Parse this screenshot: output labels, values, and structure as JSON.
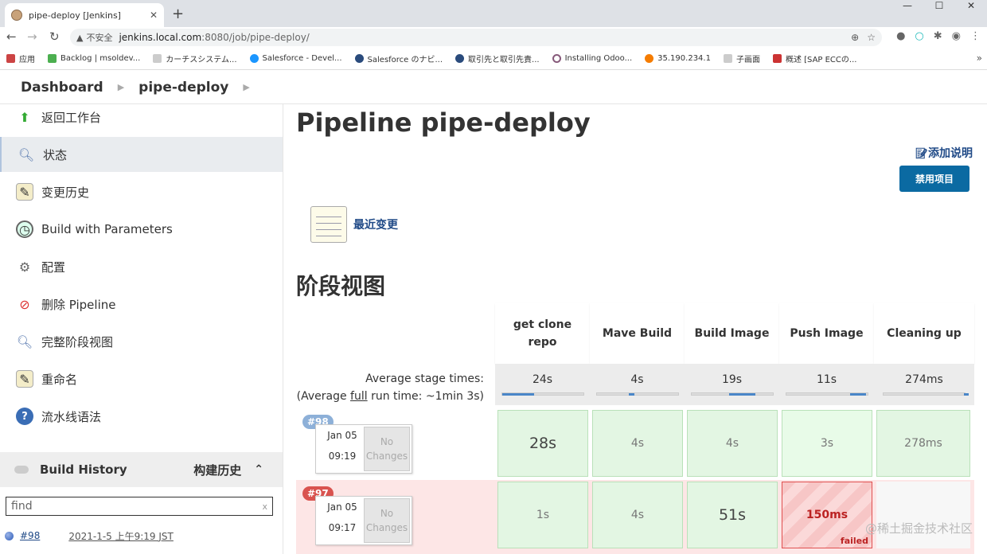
{
  "browser": {
    "tab_title": "pipe-deploy [Jenkins]",
    "url_security": "不安全",
    "url_host": "jenkins.local.com",
    "url_path": ":8080/job/pipe-deploy/",
    "bookmarks": [
      "应用",
      "Backlog | msoldev...",
      "カーチスシステム...",
      "Salesforce - Devel...",
      "Salesforce のナビ...",
      "取引先と取引先責...",
      "Installing Odoo...",
      "35.190.234.1",
      "子画面",
      "概述 [SAP ECCの..."
    ]
  },
  "breadcrumb": {
    "dashboard": "Dashboard",
    "job": "pipe-deploy"
  },
  "sidebar": {
    "items": [
      {
        "label": "返回工作台",
        "icon": "up-arrow-icon"
      },
      {
        "label": "状态",
        "icon": "search-icon"
      },
      {
        "label": "变更历史",
        "icon": "notepad-icon"
      },
      {
        "label": "Build with Parameters",
        "icon": "clock-icon"
      },
      {
        "label": "配置",
        "icon": "gear-icon"
      },
      {
        "label": "删除 Pipeline",
        "icon": "no-entry-icon"
      },
      {
        "label": "完整阶段视图",
        "icon": "search-icon"
      },
      {
        "label": "重命名",
        "icon": "notepad-icon"
      },
      {
        "label": "流水线语法",
        "icon": "help-icon"
      }
    ],
    "build_history_label": "Build History",
    "build_history_zh": "构建历史",
    "find_placeholder": "find",
    "find_clear": "x",
    "history_row": {
      "build": "#98",
      "date": "2021-1-5 上午9:19 JST"
    }
  },
  "main": {
    "title": "Pipeline pipe-deploy",
    "add_description": "添加说明",
    "disable_button": "禁用项目",
    "recent_changes": "最近变更",
    "stage_view_title": "阶段视图",
    "avg_label_1": "Average stage times:",
    "avg_label_2a": "(Average ",
    "avg_label_2b": "full",
    "avg_label_2c": " run time: ~1min 3s)",
    "no_changes": "No Changes"
  },
  "stages": [
    {
      "name": "get clone repo",
      "avg": "24s",
      "bar_start": 0.0,
      "bar_fill": 0.4
    },
    {
      "name": "Mave Build",
      "avg": "4s",
      "bar_start": 0.4,
      "bar_fill": 0.07
    },
    {
      "name": "Build Image",
      "avg": "19s",
      "bar_start": 0.47,
      "bar_fill": 0.32
    },
    {
      "name": "Push Image",
      "avg": "11s",
      "bar_start": 0.79,
      "bar_fill": 0.2
    },
    {
      "name": "Cleaning up",
      "avg": "274ms",
      "bar_start": 0.99,
      "bar_fill": 0.01
    }
  ],
  "builds": [
    {
      "id": "#98",
      "date": "Jan 05",
      "time": "09:19",
      "status": "success",
      "cells": [
        "28s",
        "4s",
        "4s",
        "3s",
        "278ms"
      ]
    },
    {
      "id": "#97",
      "date": "Jan 05",
      "time": "09:17",
      "status": "failed",
      "cells": [
        "1s",
        "4s",
        "51s",
        "150ms",
        ""
      ],
      "failed_label": "failed"
    }
  ],
  "colors": {
    "link": "#204a87",
    "primary_button": "#0b6aa2",
    "success_cell": "#e3f6e3",
    "failed_row": "#fde6e6",
    "badge_ok": "#8db0d8",
    "badge_fail": "#d9534f"
  },
  "watermark": "@稀土掘金技术社区"
}
